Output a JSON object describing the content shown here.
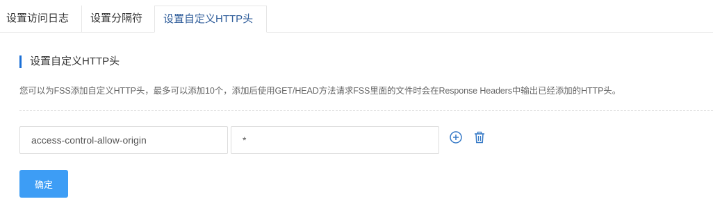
{
  "tabs": [
    {
      "label": "设置访问日志"
    },
    {
      "label": "设置分隔符"
    },
    {
      "label": "设置自定义HTTP头",
      "active": true
    }
  ],
  "section": {
    "title": "设置自定义HTTP头",
    "description": "您可以为FSS添加自定义HTTP头，最多可以添加10个，添加后使用GET/HEAD方法请求FSS里面的文件时会在Response Headers中输出已经添加的HTTP头。"
  },
  "header_row": {
    "key_value": "access-control-allow-origin",
    "value_value": "*",
    "add_icon": "plus-circle-icon",
    "delete_icon": "trash-icon"
  },
  "actions": {
    "confirm_label": "确定"
  },
  "colors": {
    "accent": "#1a6fd6",
    "active_tab_text": "#2f5d9a",
    "primary_button": "#3d9df5",
    "icon": "#3478c6"
  }
}
